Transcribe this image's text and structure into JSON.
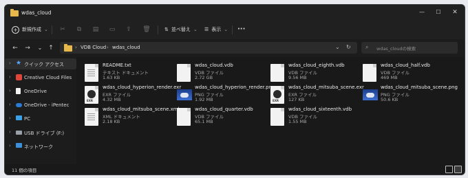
{
  "window": {
    "title": "wdas_cloud"
  },
  "toolbar": {
    "new_label": "新規作成",
    "sort_label": "並べ替え",
    "view_label": "表示",
    "more_label": "···"
  },
  "nav": {
    "back": "←",
    "forward": "→",
    "dropdown": "⌄",
    "up": "↑"
  },
  "address": {
    "crumbs": [
      "VDB Cloud",
      "wdas_cloud"
    ]
  },
  "search": {
    "placeholder": "wdas_cloudの検索"
  },
  "sidebar": {
    "items": [
      {
        "label": "クイック アクセス",
        "icon": "star-icon",
        "selected": true
      },
      {
        "label": "Creative Cloud Files",
        "icon": "creative-cloud-icon",
        "selected": false
      },
      {
        "label": "OneDrive",
        "icon": "file-icon",
        "selected": false
      },
      {
        "label": "OneDrive - iPentec",
        "icon": "cloud-icon",
        "selected": false
      },
      {
        "label": "PC",
        "icon": "pc-icon",
        "selected": false
      },
      {
        "label": "USB ドライブ (F:)",
        "icon": "usb-drive-icon",
        "selected": false
      },
      {
        "label": "ネットワーク",
        "icon": "network-icon",
        "selected": false
      }
    ]
  },
  "files": [
    {
      "name": "README.txt",
      "type": "テキスト ドキュメント",
      "size": "1.63 KB",
      "thumb": "text"
    },
    {
      "name": "wdas_cloud.vdb",
      "type": "VDB ファイル",
      "size": "2.72 GB",
      "thumb": "blank"
    },
    {
      "name": "wdas_cloud_eighth.vdb",
      "type": "VDB ファイル",
      "size": "9.56 MB",
      "thumb": "blank"
    },
    {
      "name": "wdas_cloud_half.vdb",
      "type": "VDB ファイル",
      "size": "469 MB",
      "thumb": "blank"
    },
    {
      "name": "wdas_cloud_hyperion_render.exr",
      "type": "EXR ファイル",
      "size": "4.32 MB",
      "thumb": "exr"
    },
    {
      "name": "wdas_cloud_hyperion_render.png",
      "type": "PNG ファイル",
      "size": "1.92 MB",
      "thumb": "png"
    },
    {
      "name": "wdas_cloud_mitsuba_scene.exr",
      "type": "EXR ファイル",
      "size": "127 KB",
      "thumb": "exr"
    },
    {
      "name": "wdas_cloud_mitsuba_scene.png",
      "type": "PNG ファイル",
      "size": "50.6 KB",
      "thumb": "png"
    },
    {
      "name": "wdas_cloud_mitsuba_scene.xml",
      "type": "XML ドキュメント",
      "size": "2.18 KB",
      "thumb": "text"
    },
    {
      "name": "wdas_cloud_quarter.vdb",
      "type": "VDB ファイル",
      "size": "65.1 MB",
      "thumb": "blank"
    },
    {
      "name": "wdas_cloud_sixteenth.vdb",
      "type": "VDB ファイル",
      "size": "1.55 MB",
      "thumb": "blank"
    }
  ],
  "status": {
    "count_label": "11 個の項目"
  },
  "colors": {
    "accent": "#4aa3ff",
    "folder": "#e8b84a",
    "background": "#191919"
  }
}
